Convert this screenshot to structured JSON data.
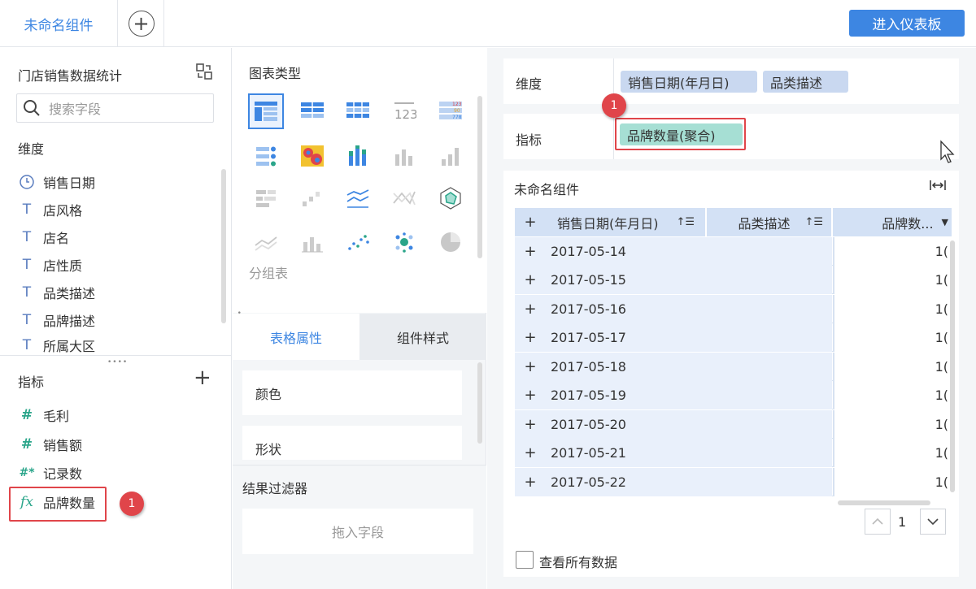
{
  "topbar": {
    "tab_label": "未命名组件",
    "add_tab_symbol": "+",
    "enter_dashboard_label": "进入仪表板",
    "accent": "#3d86e2"
  },
  "left": {
    "dataset_name": "门店销售数据统计",
    "search_placeholder": "搜索字段",
    "dimensions_title": "维度",
    "dimensions": [
      {
        "label": "销售日期",
        "icon": "clock-icon"
      },
      {
        "label": "店风格",
        "icon": "text-type-icon"
      },
      {
        "label": "店名",
        "icon": "text-type-icon"
      },
      {
        "label": "店性质",
        "icon": "text-type-icon"
      },
      {
        "label": "品类描述",
        "icon": "text-type-icon"
      },
      {
        "label": "品牌描述",
        "icon": "text-type-icon"
      },
      {
        "label": "所属大区",
        "icon": "text-type-icon"
      }
    ],
    "metrics_title": "指标",
    "add_metric_symbol": "+",
    "metrics": [
      {
        "label": "毛利",
        "icon": "number-type-icon",
        "symbol": "#"
      },
      {
        "label": "销售额",
        "icon": "number-type-icon",
        "symbol": "#"
      },
      {
        "label": "记录数",
        "icon": "record-count-icon",
        "symbol": "#*"
      },
      {
        "label": "品牌数量",
        "icon": "formula-icon",
        "symbol": "fx"
      }
    ],
    "callout_number": "1"
  },
  "middle": {
    "chart_type_title": "图表类型",
    "group_table_label": "分组表",
    "tab_table_props": "表格属性",
    "tab_component_style": "组件样式",
    "prop_color": "颜色",
    "prop_shape": "形状",
    "result_filter_title": "结果过滤器",
    "drop_field_placeholder": "拖入字段"
  },
  "right": {
    "dimension_label": "维度",
    "dimension_pills": [
      "销售日期(年月日)",
      "品类描述"
    ],
    "metric_label": "指标",
    "metric_pill": "品牌数量(聚合)",
    "callout_number": "1",
    "widget_title": "未命名组件",
    "table": {
      "headers": [
        "销售日期(年月日)",
        "品类描述",
        "品牌数..."
      ],
      "rows": [
        {
          "date": "2017-05-14",
          "value": "1("
        },
        {
          "date": "2017-05-15",
          "value": "1("
        },
        {
          "date": "2017-05-16",
          "value": "1("
        },
        {
          "date": "2017-05-17",
          "value": "1("
        },
        {
          "date": "2017-05-18",
          "value": "1("
        },
        {
          "date": "2017-05-19",
          "value": "1("
        },
        {
          "date": "2017-05-20",
          "value": "1("
        },
        {
          "date": "2017-05-21",
          "value": "1("
        },
        {
          "date": "2017-05-22",
          "value": "1("
        }
      ]
    },
    "page_number": "1",
    "view_all_label": "查看所有数据",
    "highlight_color": "#e0454a"
  }
}
